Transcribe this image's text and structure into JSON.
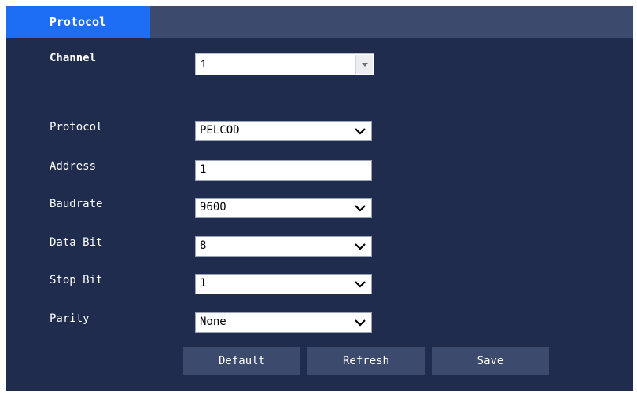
{
  "tab": {
    "label": "Protocol"
  },
  "channel": {
    "label": "Channel",
    "value": "1"
  },
  "form": {
    "protocol": {
      "label": "Protocol",
      "value": "PELCOD"
    },
    "address": {
      "label": "Address",
      "value": "1"
    },
    "baudrate": {
      "label": "Baudrate",
      "value": "9600"
    },
    "data_bit": {
      "label": "Data Bit",
      "value": "8"
    },
    "stop_bit": {
      "label": "Stop Bit",
      "value": "1"
    },
    "parity": {
      "label": "Parity",
      "value": "None"
    }
  },
  "buttons": {
    "default": "Default",
    "refresh": "Refresh",
    "save": "Save"
  },
  "colors": {
    "panel_bg": "#1f2c4e",
    "tab_active": "#1e6ef5",
    "tabbar_bg": "#3c4a6d",
    "button_bg": "#3c4a6d"
  },
  "icons": {
    "dropdown": "chevron-down-icon",
    "combo_arrow": "triangle-down-icon"
  }
}
